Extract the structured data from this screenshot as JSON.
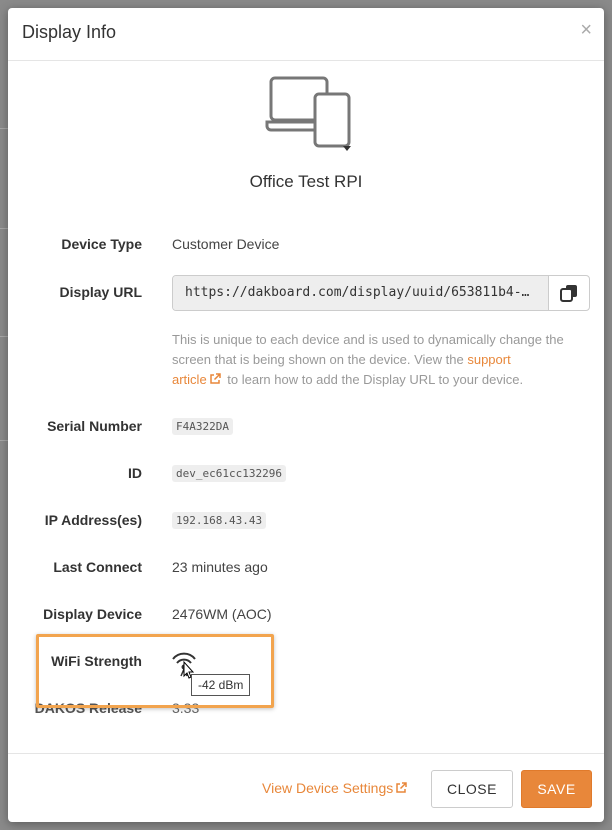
{
  "modal": {
    "title": "Display Info",
    "close_glyph": "×",
    "device_icon": "devices-icon",
    "device_name": "Office Test RPI"
  },
  "fields": {
    "device_type_label": "Device Type",
    "device_type_value": "Customer Device",
    "display_url_label": "Display URL",
    "display_url_value": "https://dakboard.com/display/uuid/653811b4-1...",
    "help_text_1": "This is unique to each device and is used to dynamically change the screen that is being shown on the device. View the ",
    "help_link_1": "support",
    "help_link_2": "article",
    "help_text_2": " to learn how to add the Display URL to your device.",
    "serial_label": "Serial Number",
    "serial_value": "F4A322DA",
    "id_label": "ID",
    "id_value": "dev_ec61cc132296",
    "ip_label": "IP Address(es)",
    "ip_value": "192.168.43.43",
    "last_connect_label": "Last Connect",
    "last_connect_value": "23 minutes ago",
    "display_device_label": "Display Device",
    "display_device_value": "2476WM (AOC)",
    "wifi_label": "WiFi Strength",
    "wifi_tooltip": "-42 dBm",
    "dakos_label": "DAKOS Release",
    "dakos_value": "3.33"
  },
  "footer": {
    "view_settings_label": "View Device Settings",
    "close_label": "CLOSE",
    "save_label": "SAVE"
  },
  "colors": {
    "accent": "#e8873a",
    "highlight": "#f2a44e"
  }
}
